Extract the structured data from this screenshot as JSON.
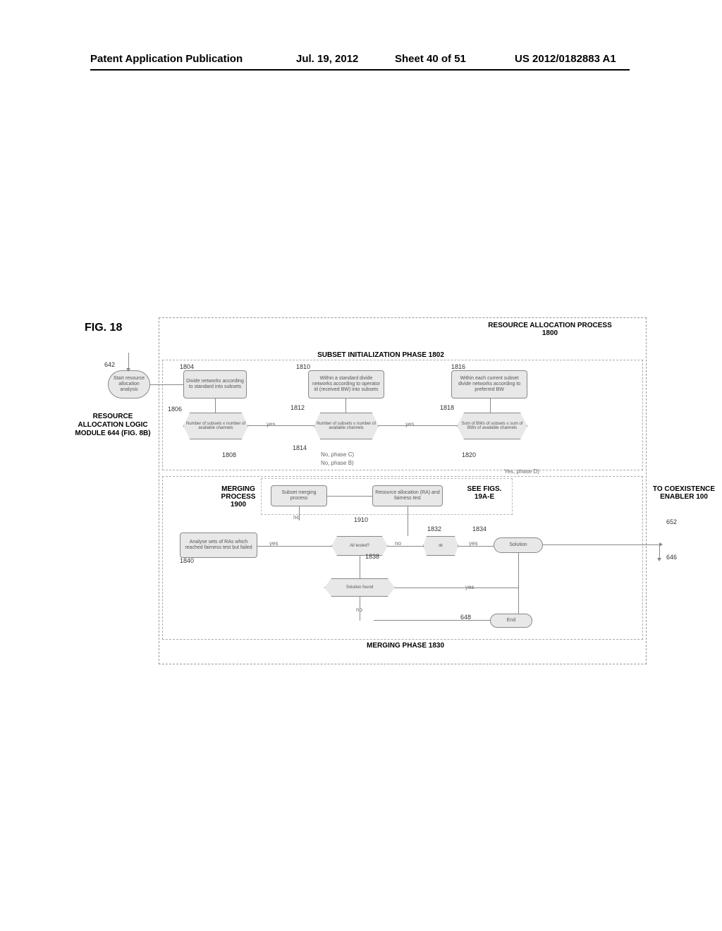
{
  "header": {
    "left": "Patent Application Publication",
    "date": "Jul. 19, 2012",
    "sheet": "Sheet 40 of 51",
    "pubno": "US 2012/0182883 A1"
  },
  "figure": {
    "title": "FIG. 18",
    "process_title": "RESOURCE ALLOCATION PROCESS 1800",
    "subset_phase_title": "SUBSET INITIALIZATION PHASE 1802",
    "merging_phase_title": "MERGING PHASE 1830",
    "merging_process_label": "MERGING PROCESS 1900",
    "see_figs": "SEE FIGS. 19A-E",
    "to_coexist": "TO COEXISTENCE ENABLER 100",
    "left_module": "RESOURCE ALLOCATION LOGIC MODULE 644 (FIG. 8B)"
  },
  "refs": {
    "r642": "642",
    "r1804": "1804",
    "r1806": "1806",
    "r1808": "1808",
    "r1810": "1810",
    "r1812": "1812",
    "r1814": "1814",
    "r1816": "1816",
    "r1818": "1818",
    "r1820": "1820",
    "r1832": "1832",
    "r1834": "1834",
    "r1838": "1838",
    "r1840": "1840",
    "r1910": "1910",
    "r646": "646",
    "r648": "648",
    "r652": "652"
  },
  "nodes": {
    "start": "Start resource allocation analysis",
    "divide_std": "Divide networks according to standard into subsets",
    "num_chan1": "Number of subsets ≤ number of available channels",
    "within_std": "Within a standard divide networks according to operator id (received BW) into subsets",
    "num_chan2": "Number of subsets ≤ number of available channels",
    "within_subset": "Within each current subset divide networks according to preferred BW",
    "sum_bw": "Sum of BWs of subsets ≤ sum of BWs of available channels",
    "subset_merge": "Subset merging process",
    "ra_fairness": "Resource allocation (RA) and fairness test",
    "all_tested": "All tested?",
    "ok": "ok",
    "solution": "Solution",
    "analyse": "Analyse sets of RAs which reached fairness test but failed",
    "solution_found": "Solution found",
    "end": "End",
    "no_phase_b": "No, phase B)",
    "no_phase_c": "No, phase C)",
    "yes_phase_d": "Yes, phase D)",
    "yes": "yes",
    "no": "no"
  }
}
